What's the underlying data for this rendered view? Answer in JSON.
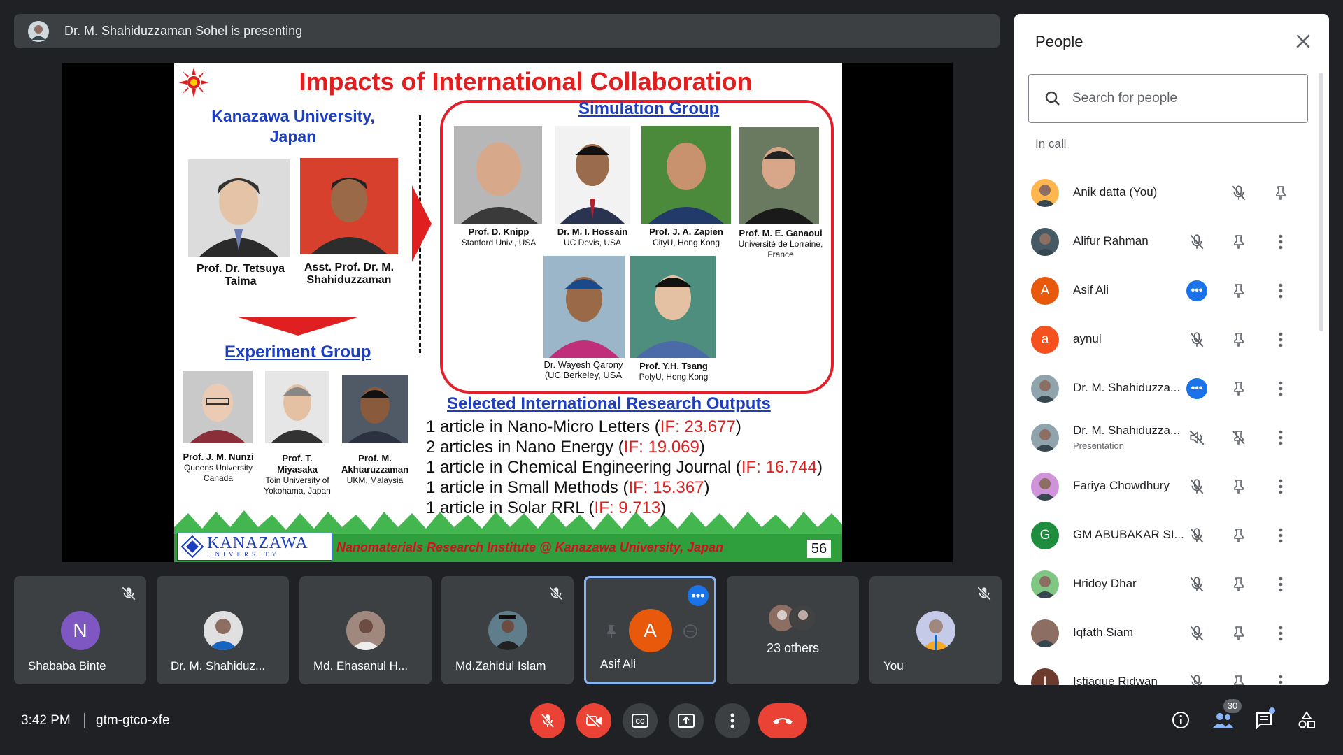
{
  "presenting": {
    "text": "Dr. M. Shahiduzzaman Sohel is presenting"
  },
  "slide": {
    "title": "Impacts of International Collaboration",
    "kanazawa_title": "Kanazawa University, Japan",
    "left_people": [
      {
        "name": "Prof. Dr. Tetsuya Taima"
      },
      {
        "name": "Asst. Prof. Dr. M. Shahiduzzaman"
      }
    ],
    "experiment_group_title": "Experiment Group",
    "experiment_people": [
      {
        "name": "Prof. J. M. Nunzi",
        "affil": "Queens University Canada"
      },
      {
        "name": "Prof. T. Miyasaka",
        "affil": "Toin University of Yokohama, Japan"
      },
      {
        "name": "Prof. M. Akhtaruzzaman",
        "affil": "UKM, Malaysia"
      }
    ],
    "simulation_group_title": "Simulation Group",
    "simulation_people": [
      {
        "name": "Prof. D. Knipp",
        "affil": "Stanford Univ., USA"
      },
      {
        "name": "Dr. M. I. Hossain",
        "affil": "UC Devis, USA"
      },
      {
        "name": "Prof. J. A. Zapien",
        "affil": "CityU, Hong Kong"
      },
      {
        "name": "Prof. M. E. Ganaoui",
        "affil": "Université de Lorraine, France"
      },
      {
        "name": "Dr. Wayesh Qarony",
        "affil": "(UC Berkeley, USA"
      },
      {
        "name": "Prof. Y.H. Tsang",
        "affil": "PolyU, Hong Kong"
      }
    ],
    "outputs_title": "Selected International Research Outputs",
    "outputs": [
      {
        "text": "1 article in Nano-Micro Letters (",
        "if": "IF: 23.677",
        "end": ")"
      },
      {
        "text": "2 articles in Nano Energy (",
        "if": "IF: 19.069",
        "end": ")"
      },
      {
        "text": "1 article in Chemical Engineering Journal (",
        "if": "IF: 16.744",
        "end": ")"
      },
      {
        "text": "1 article in Small Methods (",
        "if": "IF: 15.367",
        "end": ")"
      },
      {
        "text": "1 article in Solar RRL (",
        "if": "IF: 9.713",
        "end": ")"
      }
    ],
    "logo_line1": "KANAZAWA",
    "logo_line2": "UNIVERSITY",
    "footer": "Nanomaterials Research Institute @ Kanazawa University, Japan",
    "page_number": "56"
  },
  "tiles": [
    {
      "name": "Shababa Binte",
      "initial": "N",
      "color": "#7e57c2"
    },
    {
      "name": "Dr. M. Shahiduz..."
    },
    {
      "name": "Md. Ehasanul H..."
    },
    {
      "name": "Md.Zahidul Islam"
    },
    {
      "name": "Asif Ali",
      "initial": "A",
      "color": "#e8590c"
    },
    {
      "label": "23 others"
    },
    {
      "name": "You"
    }
  ],
  "bottom": {
    "time": "3:42 PM",
    "meeting_code": "gtm-gtco-xfe",
    "people_count": "30"
  },
  "people_panel": {
    "title": "People",
    "search_placeholder": "Search for people",
    "section": "In call",
    "participants": [
      {
        "name": "Anik datta (You)"
      },
      {
        "name": "Alifur Rahman"
      },
      {
        "name": "Asif Ali",
        "initial": "A",
        "color": "#e8590c"
      },
      {
        "name": "aynul",
        "initial": "a",
        "color": "#f4511e"
      },
      {
        "name": "Dr. M. Shahiduzza..."
      },
      {
        "name": "Dr. M. Shahiduzza...",
        "sub": "Presentation"
      },
      {
        "name": "Fariya Chowdhury"
      },
      {
        "name": "GM ABUBAKAR SI...",
        "initial": "G",
        "color": "#1e8e3e"
      },
      {
        "name": "Hridoy Dhar"
      },
      {
        "name": "Iqfath Siam"
      },
      {
        "name": "Istiaque Ridwan",
        "initial": "I",
        "color": "#6d3b2e"
      }
    ]
  }
}
